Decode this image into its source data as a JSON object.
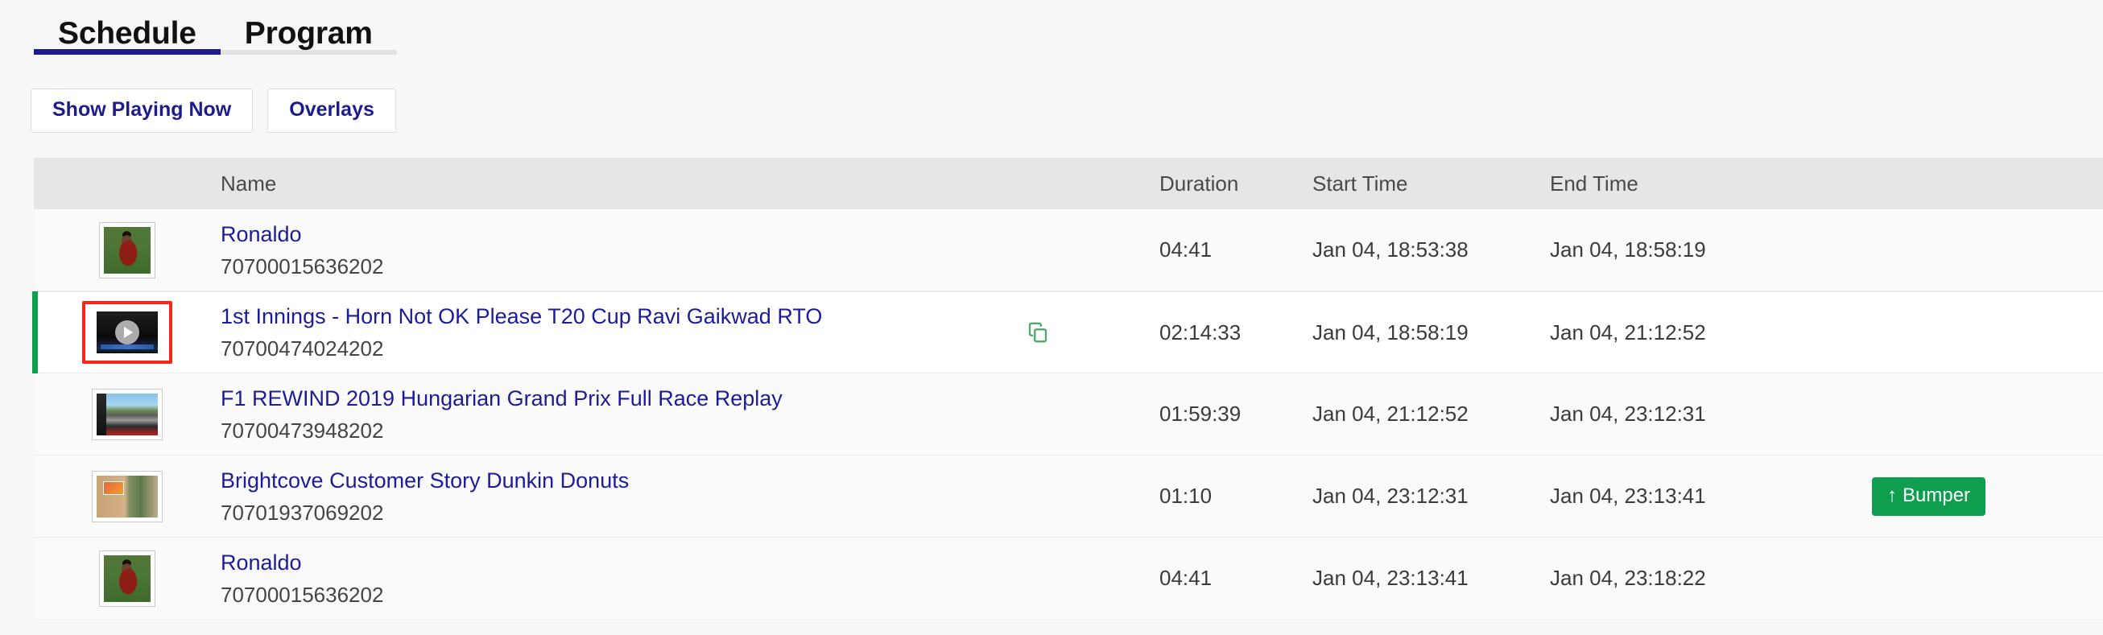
{
  "tabs": [
    {
      "label": "Schedule",
      "active": true
    },
    {
      "label": "Program",
      "active": false
    }
  ],
  "toolbar": {
    "show_playing_now_label": "Show Playing Now",
    "overlays_label": "Overlays"
  },
  "table": {
    "columns": {
      "name": "Name",
      "duration": "Duration",
      "start_time": "Start Time",
      "end_time": "End Time"
    },
    "rows": [
      {
        "title": "Ronaldo",
        "id": "70700015636202",
        "duration": "04:41",
        "start_time": "Jan 04, 18:53:38",
        "end_time": "Jan 04, 18:58:19",
        "badge": "",
        "selected": false,
        "has_copy_icon": false,
        "thumb_art": "art-ronaldo",
        "thumb_play": false
      },
      {
        "title": "1st Innings - Horn Not OK Please T20 Cup Ravi Gaikwad RTO",
        "id": "70700474024202",
        "duration": "02:14:33",
        "start_time": "Jan 04, 18:58:19",
        "end_time": "Jan 04, 21:12:52",
        "badge": "",
        "selected": true,
        "has_copy_icon": true,
        "thumb_art": "art-cricket",
        "thumb_play": true
      },
      {
        "title": "F1 REWIND 2019 Hungarian Grand Prix Full Race Replay",
        "id": "70700473948202",
        "duration": "01:59:39",
        "start_time": "Jan 04, 21:12:52",
        "end_time": "Jan 04, 23:12:31",
        "badge": "",
        "selected": false,
        "has_copy_icon": false,
        "thumb_art": "art-f1",
        "thumb_play": false
      },
      {
        "title": "Brightcove Customer Story Dunkin Donuts",
        "id": "70701937069202",
        "duration": "01:10",
        "start_time": "Jan 04, 23:12:31",
        "end_time": "Jan 04, 23:13:41",
        "badge": "Bumper",
        "badge_arrow": "↑",
        "selected": false,
        "has_copy_icon": false,
        "thumb_art": "art-dunkin",
        "thumb_play": false
      },
      {
        "title": "Ronaldo",
        "id": "70700015636202",
        "duration": "04:41",
        "start_time": "Jan 04, 23:13:41",
        "end_time": "Jan 04, 23:18:22",
        "badge": "",
        "selected": false,
        "has_copy_icon": false,
        "thumb_art": "art-ronaldo",
        "thumb_play": false
      }
    ]
  },
  "colors": {
    "tab_active_underline": "#1c1c8c",
    "tab_inactive_underline": "#e2e2e2",
    "link": "#1c1c99",
    "selected_accent": "#0e9f4f",
    "thumb_highlight": "#f42718",
    "badge_bg": "#0f9d4f",
    "copy_icon": "#4eab6e",
    "header_bg": "#e6e6e6"
  },
  "icons": {
    "copy": "copy-icon",
    "play": "play-icon",
    "badge_arrow": "arrow-up-icon"
  }
}
